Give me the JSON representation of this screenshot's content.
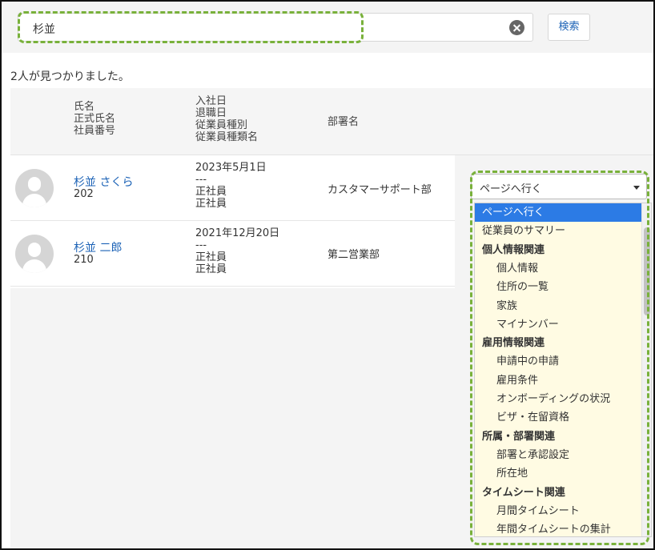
{
  "search": {
    "value": "杉並",
    "button_label": "検索"
  },
  "result_count": "2人が見つかりました。",
  "table": {
    "header": {
      "name_col": [
        "氏名",
        "正式氏名",
        "社員番号"
      ],
      "date_col": [
        "入社日",
        "退職日",
        "従業員種別",
        "従業員種類名"
      ],
      "dept_col": "部署名"
    },
    "rows": [
      {
        "name": "杉並 さくら",
        "emp_no": "202",
        "dates": [
          "2023年5月1日",
          "---",
          "正社員",
          "正社員"
        ],
        "dept": "カスタマーサポート部"
      },
      {
        "name": "杉並 二郎",
        "emp_no": "210",
        "dates": [
          "2021年12月20日",
          "---",
          "正社員",
          "正社員"
        ],
        "dept": "第二営業部"
      }
    ]
  },
  "dropdown": {
    "selected_value": "ページへ行く",
    "options": [
      {
        "label": "ページへ行く",
        "kind": "selected"
      },
      {
        "label": "従業員のサマリー",
        "kind": "item"
      },
      {
        "label": "個人情報関連",
        "kind": "group"
      },
      {
        "label": "個人情報",
        "kind": "sub"
      },
      {
        "label": "住所の一覧",
        "kind": "sub"
      },
      {
        "label": "家族",
        "kind": "sub"
      },
      {
        "label": "マイナンバー",
        "kind": "sub"
      },
      {
        "label": "雇用情報関連",
        "kind": "group"
      },
      {
        "label": "申請中の申請",
        "kind": "sub"
      },
      {
        "label": "雇用条件",
        "kind": "sub"
      },
      {
        "label": "オンボーディングの状況",
        "kind": "sub"
      },
      {
        "label": "ビザ・在留資格",
        "kind": "sub"
      },
      {
        "label": "所属・部署関連",
        "kind": "group"
      },
      {
        "label": "部署と承認設定",
        "kind": "sub"
      },
      {
        "label": "所在地",
        "kind": "sub"
      },
      {
        "label": "タイムシート関連",
        "kind": "group"
      },
      {
        "label": "月間タイムシート",
        "kind": "sub"
      },
      {
        "label": "年間タイムシートの集計",
        "kind": "sub"
      }
    ]
  },
  "colors": {
    "link": "#1b62b6",
    "highlight_dash": "#79b13b",
    "menu_bg": "#fffbe3",
    "selected_bg": "#2c7be5"
  }
}
